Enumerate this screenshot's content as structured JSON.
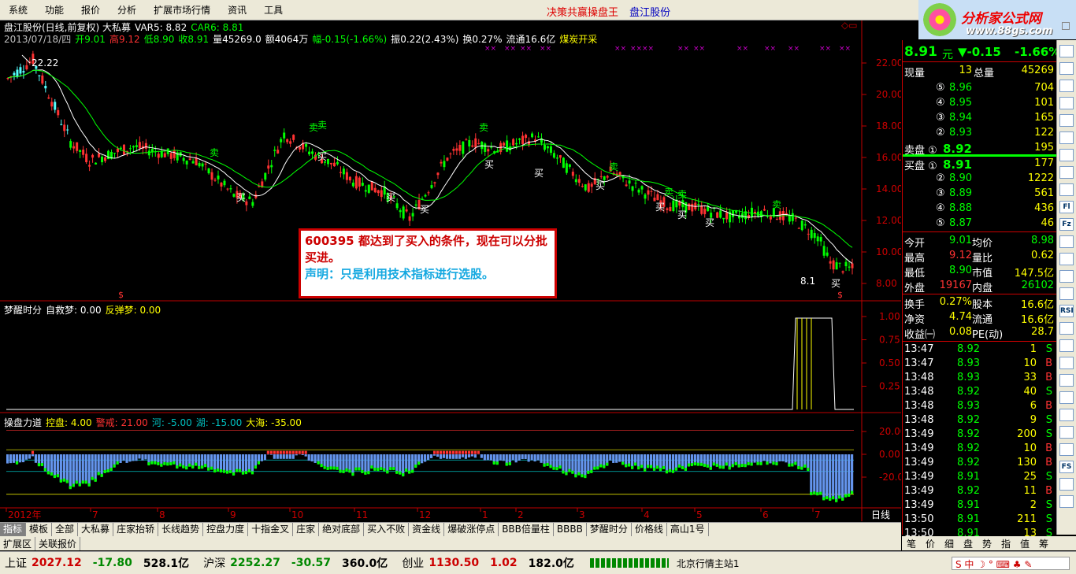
{
  "menu": [
    "系统",
    "功能",
    "报价",
    "分析",
    "扩展市场行情",
    "资讯",
    "工具"
  ],
  "menu_slogan": "决策共赢操盘王",
  "menu_stock": "盘江股份",
  "logo": {
    "title": "分析家公式网",
    "url": "www.88gs.com"
  },
  "kline": {
    "title": [
      {
        "t": "盘江股份(日线,前复权) 大私募",
        "c": "#ffffff"
      },
      {
        "t": "VAR5: 8.82",
        "c": "#ffffff"
      },
      {
        "t": "CAR6: 8.81",
        "c": "#00ff00"
      }
    ],
    "info": [
      {
        "t": "2013/07/18/四",
        "c": "#c0c0c0"
      },
      {
        "t": "开9.01",
        "c": "#00ff00"
      },
      {
        "t": "高9.12",
        "c": "#ff3232"
      },
      {
        "t": "低8.90",
        "c": "#00ff00"
      },
      {
        "t": "收8.91",
        "c": "#00ff00"
      },
      {
        "t": "量45269.0",
        "c": "#ffffff"
      },
      {
        "t": "额4064万",
        "c": "#ffffff"
      },
      {
        "t": "幅-0.15(-1.66%)",
        "c": "#00ff00"
      },
      {
        "t": "振0.22(2.43%)",
        "c": "#ffffff"
      },
      {
        "t": "换0.27%",
        "c": "#ffffff"
      },
      {
        "t": "流通16.6亿",
        "c": "#ffffff"
      },
      {
        "t": "煤炭开采",
        "c": "#ffff00"
      }
    ],
    "hi_label": "22.22",
    "lo_label": "8.1",
    "y_ticks": [
      "22.00",
      "20.00",
      "18.00",
      "16.00",
      "14.00",
      "12.00",
      "10.00",
      "8.00"
    ],
    "buy_label": "买",
    "sell_label": "卖",
    "s_mark": "$"
  },
  "panel2": {
    "title": [
      {
        "t": "梦醒时分",
        "c": "#ffffff"
      },
      {
        "t": "自救梦: 0.00",
        "c": "#ffffff"
      },
      {
        "t": "反弹梦: 0.00",
        "c": "#ffff00"
      }
    ],
    "y_ticks": [
      "1.00",
      "0.75",
      "0.50",
      "0.25"
    ]
  },
  "panel3": {
    "title": [
      {
        "t": "操盘力道",
        "c": "#ffffff"
      },
      {
        "t": "控盘: 4.00",
        "c": "#ffff00"
      },
      {
        "t": "警戒: 21.00",
        "c": "#ff3232"
      },
      {
        "t": "河: -5.00",
        "c": "#00c0c0"
      },
      {
        "t": "湖: -15.00",
        "c": "#00c0c0"
      },
      {
        "t": "大海: -35.00",
        "c": "#ffff00"
      }
    ],
    "y_ticks": [
      "20.00",
      "0.00",
      "-20.00"
    ]
  },
  "x_labels": [
    "2012年",
    "7",
    "8",
    "9",
    "10",
    "11",
    "12",
    "1",
    "2",
    "3",
    "4",
    "5",
    "6",
    "7"
  ],
  "period": "日线",
  "note": {
    "line1": "600395 都达到了买入的条件，现在可以分批买进。",
    "line2": "声明：只是利用技术指标进行选股。"
  },
  "quote": {
    "price": "8.91",
    "unit": "元",
    "change": "▼-0.15",
    "pct": "-1.66%",
    "vol_now_label": "现量",
    "vol_now": "13",
    "vol_total_label": "总量",
    "vol_total": "45269",
    "asks": [
      {
        "l": "⑤",
        "p": "8.96",
        "v": "704"
      },
      {
        "l": "④",
        "p": "8.95",
        "v": "101"
      },
      {
        "l": "③",
        "p": "8.94",
        "v": "165"
      },
      {
        "l": "②",
        "p": "8.93",
        "v": "122"
      },
      {
        "l": "卖盘 ①",
        "p": "8.92",
        "v": "195"
      }
    ],
    "bids": [
      {
        "l": "买盘 ①",
        "p": "8.91",
        "v": "177"
      },
      {
        "l": "②",
        "p": "8.90",
        "v": "1222"
      },
      {
        "l": "③",
        "p": "8.89",
        "v": "561"
      },
      {
        "l": "④",
        "p": "8.88",
        "v": "436"
      },
      {
        "l": "⑤",
        "p": "8.87",
        "v": "46"
      }
    ],
    "stats": [
      [
        {
          "t": "今开",
          "c": "#fff"
        },
        {
          "t": "9.01",
          "c": "#0f0"
        },
        {
          "t": "均价",
          "c": "#fff"
        },
        {
          "t": "8.98",
          "c": "#0f0"
        }
      ],
      [
        {
          "t": "最高",
          "c": "#fff"
        },
        {
          "t": "9.12",
          "c": "#f33"
        },
        {
          "t": "量比",
          "c": "#fff"
        },
        {
          "t": "0.62",
          "c": "#ff0"
        }
      ],
      [
        {
          "t": "最低",
          "c": "#fff"
        },
        {
          "t": "8.90",
          "c": "#0f0"
        },
        {
          "t": "市值",
          "c": "#fff"
        },
        {
          "t": "147.5亿",
          "c": "#ff0"
        }
      ],
      [
        {
          "t": "外盘",
          "c": "#fff"
        },
        {
          "t": "19167",
          "c": "#f33"
        },
        {
          "t": "内盘",
          "c": "#fff"
        },
        {
          "t": "26102",
          "c": "#0f0"
        }
      ]
    ],
    "stats2": [
      [
        {
          "t": "换手",
          "c": "#fff"
        },
        {
          "t": "0.27%",
          "c": "#ff0"
        },
        {
          "t": "股本",
          "c": "#fff"
        },
        {
          "t": "16.6亿",
          "c": "#ff0"
        }
      ],
      [
        {
          "t": "净资",
          "c": "#fff"
        },
        {
          "t": "4.74",
          "c": "#ff0"
        },
        {
          "t": "流通",
          "c": "#fff"
        },
        {
          "t": "16.6亿",
          "c": "#ff0"
        }
      ],
      [
        {
          "t": "收益㈠",
          "c": "#fff"
        },
        {
          "t": "0.08",
          "c": "#ff0"
        },
        {
          "t": "PE(动)",
          "c": "#fff"
        },
        {
          "t": "28.7",
          "c": "#ff0"
        }
      ]
    ],
    "ticks": [
      {
        "t": "13:47",
        "p": "8.92",
        "v": "1",
        "d": "S"
      },
      {
        "t": "13:47",
        "p": "8.93",
        "v": "10",
        "d": "B"
      },
      {
        "t": "13:48",
        "p": "8.93",
        "v": "33",
        "d": "B"
      },
      {
        "t": "13:48",
        "p": "8.92",
        "v": "40",
        "d": "S"
      },
      {
        "t": "13:48",
        "p": "8.93",
        "v": "6",
        "d": "B"
      },
      {
        "t": "13:48",
        "p": "8.92",
        "v": "9",
        "d": "S"
      },
      {
        "t": "13:49",
        "p": "8.92",
        "v": "200",
        "d": "S"
      },
      {
        "t": "13:49",
        "p": "8.92",
        "v": "10",
        "d": "B"
      },
      {
        "t": "13:49",
        "p": "8.92",
        "v": "130",
        "d": "B"
      },
      {
        "t": "13:49",
        "p": "8.91",
        "v": "25",
        "d": "S"
      },
      {
        "t": "13:49",
        "p": "8.92",
        "v": "11",
        "d": "B"
      },
      {
        "t": "13:49",
        "p": "8.91",
        "v": "2",
        "d": "S"
      },
      {
        "t": "13:50",
        "p": "8.91",
        "v": "211",
        "d": "S"
      },
      {
        "t": "13:50",
        "p": "8.91",
        "v": "13",
        "d": "S"
      }
    ]
  },
  "tabs": [
    "指标",
    "模板",
    "全部",
    "大私募",
    "庄家抬轿",
    "长线趋势",
    "控盘力度",
    "十指金叉",
    "庄家",
    "绝对底部",
    "买入不败",
    "资金线",
    "爆破涨停点",
    "BBB倍量柱",
    "BBBB",
    "梦醒时分",
    "价格线",
    "高山1号"
  ],
  "tabs_extra": [
    "扩展区",
    "关联报价"
  ],
  "quote_tabs": [
    "笔",
    "价",
    "细",
    "盘",
    "势",
    "指",
    "值",
    "筹"
  ],
  "tools": [
    "",
    "",
    "",
    "",
    "",
    "",
    "",
    "",
    "",
    "Fl",
    "Fz",
    "",
    "",
    "",
    "",
    "RSI",
    "",
    "",
    "",
    "",
    "",
    "",
    "",
    "",
    "FS",
    "",
    ""
  ],
  "status": {
    "sh_label": "上证",
    "sh_val": "2027.12",
    "sh_chg": "-17.80",
    "sh_amt": "528.1亿",
    "hs_label": "沪深",
    "hs_val": "2252.27",
    "hs_chg": "-30.57",
    "hs_amt": "360.0亿",
    "cy_label": "创业",
    "cy_val": "1130.50",
    "cy_chg": "1.02",
    "cy_amt": "182.0亿",
    "server": "北京行情主站1"
  },
  "colors": {
    "up": "#ff3232",
    "down": "#00ff00",
    "ma1": "#ffffff",
    "ma2": "#00ff00",
    "bar_blue": "#6495ed",
    "axis": "#c00000"
  }
}
